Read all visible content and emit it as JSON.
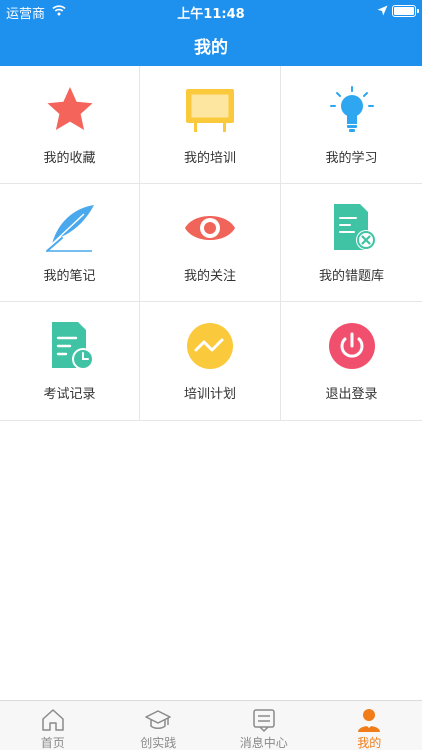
{
  "status_bar": {
    "carrier": "运营商",
    "time": "上午11:48"
  },
  "header": {
    "title": "我的"
  },
  "menu": [
    {
      "label": "我的收藏",
      "icon": "star-icon"
    },
    {
      "label": "我的培训",
      "icon": "easel-board-icon"
    },
    {
      "label": "我的学习",
      "icon": "lightbulb-icon"
    },
    {
      "label": "我的笔记",
      "icon": "feather-quill-icon"
    },
    {
      "label": "我的关注",
      "icon": "eye-icon"
    },
    {
      "label": "我的错题库",
      "icon": "document-wrong-icon"
    },
    {
      "label": "考试记录",
      "icon": "document-clock-icon"
    },
    {
      "label": "培训计划",
      "icon": "trend-wave-icon"
    },
    {
      "label": "退出登录",
      "icon": "power-icon"
    }
  ],
  "tab_bar": {
    "tabs": [
      {
        "label": "首页",
        "icon": "home-icon",
        "active": false
      },
      {
        "label": "创实践",
        "icon": "graduation-cap-icon",
        "active": false
      },
      {
        "label": "消息中心",
        "icon": "message-icon",
        "active": false
      },
      {
        "label": "我的",
        "icon": "person-icon",
        "active": true
      }
    ]
  },
  "colors": {
    "primary": "#1e90ee",
    "active_tab": "#f07d1a",
    "star": "#f4645a",
    "easel": "#fbc93c",
    "bulb": "#2ea7f0",
    "feather": "#4aa8ec",
    "eye": "#f0645a",
    "doc_teal": "#3fc3a4",
    "wave": "#fbc93c",
    "power": "#f0506e"
  }
}
